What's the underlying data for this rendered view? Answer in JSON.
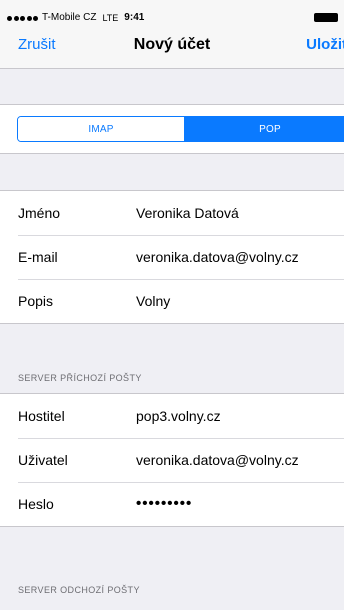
{
  "status_bar": {
    "carrier": "T-Mobile CZ",
    "network": "LTE",
    "time": "9:41"
  },
  "nav": {
    "cancel_label": "Zrušit",
    "title": "Nový účet",
    "save_label": "Uložit"
  },
  "account_type": {
    "options": [
      "IMAP",
      "POP"
    ],
    "selected": "POP"
  },
  "account": {
    "rows": [
      {
        "label": "Jméno",
        "value": "Veronika Datová"
      },
      {
        "label": "E-mail",
        "value": "veronika.datova@volny.cz"
      },
      {
        "label": "Popis",
        "value": "Volny"
      }
    ]
  },
  "incoming": {
    "header": "SERVER PŘÍCHOZÍ POŠTY",
    "rows": [
      {
        "label": "Hostitel",
        "value": "pop3.volny.cz"
      },
      {
        "label": "Uživatel",
        "value": "veronika.datova@volny.cz"
      },
      {
        "label": "Heslo",
        "value": "•••••••••"
      }
    ]
  },
  "outgoing": {
    "header": "SERVER ODCHOZÍ POŠTY"
  },
  "colors": {
    "accent": "#0a7aff",
    "carrier_brand": "#e20074",
    "background": "#efeff4"
  }
}
